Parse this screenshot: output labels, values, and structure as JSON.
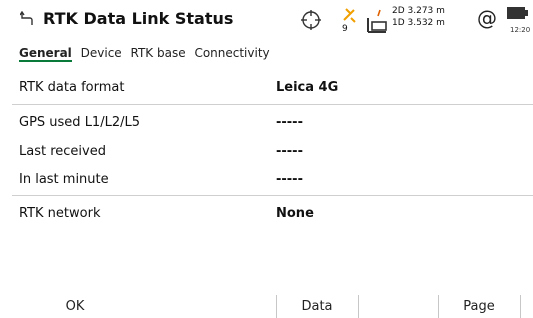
{
  "header": {
    "title": "RTK Data Link Status",
    "sat_count": "9",
    "quality_2d": "2D 3.273 m",
    "quality_1d": "1D 3.532 m",
    "at_symbol": "@",
    "clock": "12:20"
  },
  "tabs": [
    {
      "label": "General",
      "active": true
    },
    {
      "label": "Device",
      "active": false
    },
    {
      "label": "RTK base",
      "active": false
    },
    {
      "label": "Connectivity",
      "active": false
    }
  ],
  "rows": [
    {
      "label": "RTK data format",
      "value": "Leica 4G"
    },
    {
      "label": "GPS used L1/L2/L5",
      "value": "-----"
    },
    {
      "label": "Last received",
      "value": "-----"
    },
    {
      "label": "In last minute",
      "value": "-----"
    },
    {
      "label": "RTK network",
      "value": "None"
    }
  ],
  "buttons": {
    "ok": "OK",
    "data": "Data",
    "page": "Page"
  },
  "colors": {
    "tab_underline": "#0a7a3a",
    "satellite_accent": "#f0a000",
    "rtk_accent": "#e06000"
  }
}
